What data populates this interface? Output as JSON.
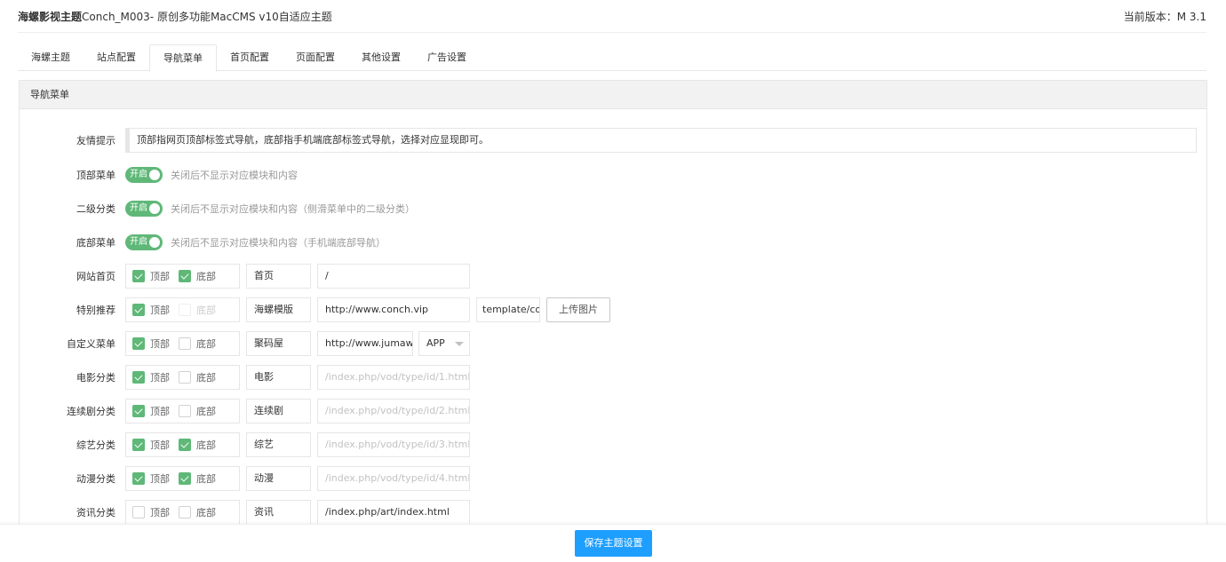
{
  "header": {
    "title_bold": "海螺影视主题",
    "title_rest": "Conch_M003- 原创多功能MacCMS v10自适应主题",
    "version_label": "当前版本：",
    "version_value": "M 3.1"
  },
  "tabs": [
    "海螺主题",
    "站点配置",
    "导航菜单",
    "首页配置",
    "页面配置",
    "其他设置",
    "广告设置"
  ],
  "active_tab": "导航菜单",
  "panel_title": "导航菜单",
  "tip": {
    "label": "友情提示",
    "text": "顶部指网页顶部标签式导航，底部指手机端底部标签式导航，选择对应显现即可。"
  },
  "switches": [
    {
      "label": "顶部菜单",
      "state": "开启",
      "hint": "关闭后不显示对应模块和内容"
    },
    {
      "label": "二级分类",
      "state": "开启",
      "hint": "关闭后不显示对应模块和内容（侧滑菜单中的二级分类）"
    },
    {
      "label": "底部菜单",
      "state": "开启",
      "hint": "关闭后不显示对应模块和内容（手机端底部导航）"
    }
  ],
  "checkbox_labels": {
    "top": "顶部",
    "bottom": "底部"
  },
  "menu_rows": [
    {
      "label": "网站首页",
      "top": true,
      "bottom": true,
      "name": "首页",
      "url": "/",
      "url_placeholder": false
    },
    {
      "label": "特别推荐",
      "top": true,
      "bottom": false,
      "bottom_disabled": true,
      "name": "海螺模版",
      "url": "http://www.conch.vip",
      "url_placeholder": false,
      "image": "template/conch",
      "upload_label": "上传图片"
    },
    {
      "label": "自定义菜单",
      "top": true,
      "bottom": false,
      "name": "聚码屋",
      "url": "http://www.jumawu.com",
      "url_placeholder": false,
      "select": "APP"
    },
    {
      "label": "电影分类",
      "top": true,
      "bottom": false,
      "name": "电影",
      "url": "/index.php/vod/type/id/1.html",
      "url_placeholder": true
    },
    {
      "label": "连续剧分类",
      "top": true,
      "bottom": false,
      "name": "连续剧",
      "url": "/index.php/vod/type/id/2.html",
      "url_placeholder": true
    },
    {
      "label": "综艺分类",
      "top": true,
      "bottom": true,
      "name": "综艺",
      "url": "/index.php/vod/type/id/3.html",
      "url_placeholder": true
    },
    {
      "label": "动漫分类",
      "top": true,
      "bottom": true,
      "name": "动漫",
      "url": "/index.php/vod/type/id/4.html",
      "url_placeholder": true
    },
    {
      "label": "资讯分类",
      "top": false,
      "bottom": false,
      "name": "资讯",
      "url": "/index.php/art/index.html",
      "url_placeholder": false
    }
  ],
  "save_label": "保存主题设置",
  "colors": {
    "switch_on": "#5FB878",
    "save_button": "#1E9FFF"
  }
}
